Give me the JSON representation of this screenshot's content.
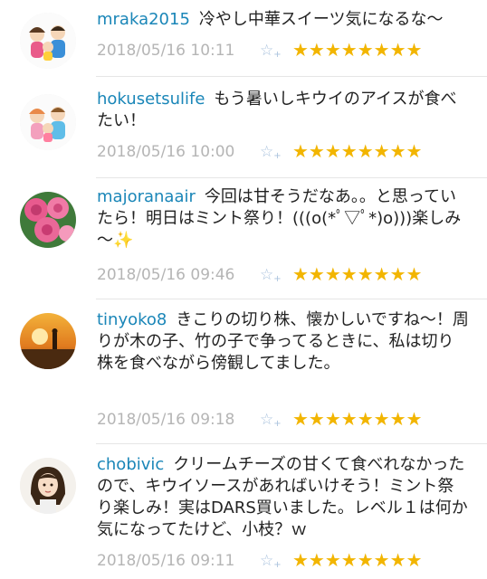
{
  "comments": [
    {
      "user": "mraka2015",
      "text": "冷やし中華スイーツ気になるな～",
      "time": "2018/05/16 10:11",
      "stars": "★★★★★★★★",
      "avatar": "family-avatar"
    },
    {
      "user": "hokusetsulife",
      "text": "もう暑いしキウイのアイスが食べたい！",
      "time": "2018/05/16 10:00",
      "stars": "★★★★★★★★",
      "avatar": "family-avatar"
    },
    {
      "user": "majoranaair",
      "text": "今回は甘そうだなあ。。と思っていたら！明日はミント祭り！(((o(*ﾟ▽ﾟ*)o)))楽しみ～✨",
      "time": "2018/05/16 09:46",
      "stars": "★★★★★★★★",
      "avatar": "roses-avatar"
    },
    {
      "user": "tinyoko8",
      "text": "きこりの切り株、懐かしいですね～！周りが木の子、竹の子で争ってるときに、私は切り株を食べながら傍観してました。",
      "time": "2018/05/16 09:18",
      "stars": "★★★★★★★★",
      "avatar": "sunset-avatar"
    },
    {
      "user": "chobivic",
      "text": "クリームチーズの甘くて食べれなかったので、キウイソースがあればいけそう！ミント祭り楽しみ！実はDARS買いました。レベル１は何か気になってたけど、小枝？ｗ",
      "time": "2018/05/16 09:11",
      "stars": "★★★★★★★★",
      "avatar": "girl-avatar"
    }
  ],
  "fav_icon": "☆",
  "fav_plus": "+"
}
